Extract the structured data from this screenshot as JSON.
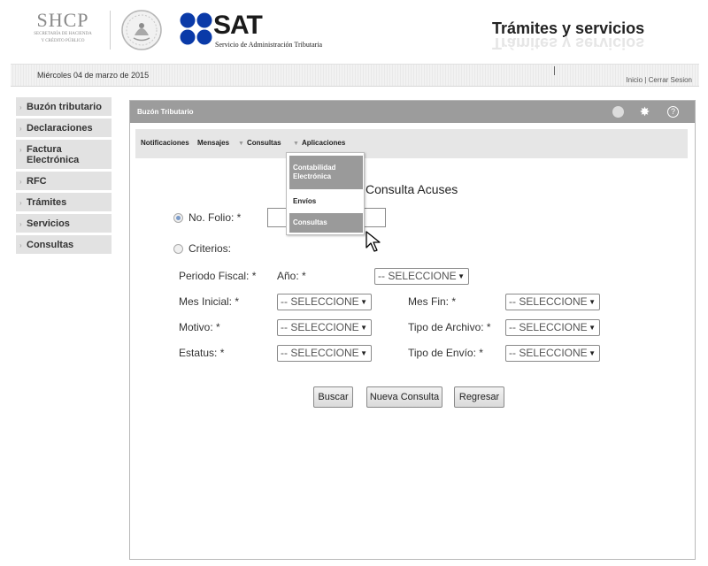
{
  "header": {
    "shcp_title": "SHCP",
    "shcp_subtitle_1": "SECRETARÍA DE HACIENDA",
    "shcp_subtitle_2": "Y CRÉDITO PÚBLICO",
    "sat_title": "SAT",
    "sat_subtitle": "Servicio de Administración Tributaria",
    "page_title": "Trámites y servicios"
  },
  "datebar": {
    "date": "Miércoles 04 de marzo de 2015",
    "link_inicio": "Inicio",
    "separator": "|",
    "link_cerrar": "Cerrar Sesion"
  },
  "sidebar": {
    "items": [
      {
        "label": "Buzón tributario"
      },
      {
        "label": "Declaraciones"
      },
      {
        "label": "Factura Electrónica"
      },
      {
        "label": "RFC"
      },
      {
        "label": "Trámites"
      },
      {
        "label": "Servicios"
      },
      {
        "label": "Consultas"
      }
    ]
  },
  "panel": {
    "title": "Buzón Tributario",
    "help_glyph": "?",
    "menu": {
      "notificaciones": "Notificaciones",
      "mensajes": "Mensajes",
      "consultas": "Consultas",
      "aplicaciones": "Aplicaciones"
    },
    "dropdown": {
      "items": [
        {
          "label": "Contabilidad Electrónica"
        },
        {
          "label": "Envíos"
        },
        {
          "label": "Consultas"
        }
      ]
    }
  },
  "form": {
    "title": "Consulta Acuses",
    "radio_folio": "No. Folio: *",
    "radio_criterios": "Criterios:",
    "folio_value": "",
    "periodo_fiscal": "Periodo Fiscal: *",
    "anio": "Año: *",
    "mes_inicial": "Mes Inicial: *",
    "mes_fin": "Mes Fin: *",
    "motivo": "Motivo: *",
    "tipo_archivo": "Tipo de Archivo: *",
    "estatus": "Estatus: *",
    "tipo_envio": "Tipo de Envío: *",
    "select_placeholder": "-- SELECCIONE",
    "btn_buscar": "Buscar",
    "btn_nueva": "Nueva Consulta",
    "btn_regresar": "Regresar"
  },
  "colors": {
    "panel_header": "#9c9c9c",
    "sidebar_item": "#e2e2e2",
    "menubar": "#e6e6e6",
    "sat_blue": "#0a3aa8",
    "dropdown_highlight": "#9a9a9a"
  },
  "icons": [
    "seal-icon",
    "sat-logo-icon",
    "status-circle-icon",
    "gear-icon",
    "help-icon",
    "chevron-right-icon",
    "arrow-down-icon",
    "hand-cursor-icon"
  ]
}
